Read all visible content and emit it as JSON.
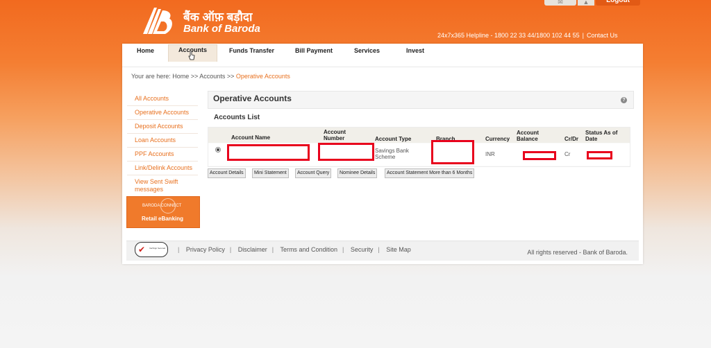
{
  "header": {
    "logo_hindi": "बैंक ऑफ़ बड़ौदा",
    "logo_english": "Bank of Baroda",
    "helpline": "24x7x365 Helpline - 1800 22 33 44/1800 102 44 55",
    "contact": "Contact Us",
    "logout": "Logout"
  },
  "nav": {
    "tabs": [
      "Home",
      "Accounts",
      "Funds Transfer",
      "Bill Payment",
      "Services",
      "Invest"
    ],
    "active": "Accounts"
  },
  "breadcrumb": {
    "prefix": "Your are here:",
    "home": "Home",
    "sep": ">>",
    "accounts": "Accounts",
    "current": "Operative Accounts"
  },
  "sidebar": {
    "items": [
      "All Accounts",
      "Operative Accounts",
      "Deposit Accounts",
      "Loan Accounts",
      "PPF Accounts",
      "Link/Delink Accounts",
      "View Sent Swift messages"
    ],
    "promo_top": "BARODA CONNECT",
    "promo_bottom": "Retail eBanking"
  },
  "main": {
    "title": "Operative Accounts",
    "list_title": "Accounts List",
    "columns": [
      "Account Name",
      "Account Number",
      "Account Type",
      "Branch",
      "Currency",
      "Account Balance",
      "Cr/Dr",
      "Status As of Date"
    ],
    "row": {
      "account_type": "Savings Bank Scheme",
      "currency": "INR",
      "cr_dr": "Cr"
    },
    "buttons": [
      "Account Details",
      "Mini Statement",
      "Account Query",
      "Nominee Details",
      "Account Statement More than 6 Months"
    ]
  },
  "footer": {
    "links": [
      "Privacy Policy",
      "Disclaimer",
      "Terms and Condition",
      "Security",
      "Site Map"
    ],
    "rights": "All rights reserved - Bank of Baroda.",
    "badge": "VeriSign Secured"
  },
  "colors": {
    "brand_orange": "#f26a1f",
    "link_orange": "#e8701e",
    "redaction_red": "#e8001c"
  },
  "icons": [
    "baroda-logo-icon",
    "mail-icon",
    "warning-icon",
    "help-icon",
    "verisign-check-icon",
    "mouse-cursor-icon"
  ]
}
